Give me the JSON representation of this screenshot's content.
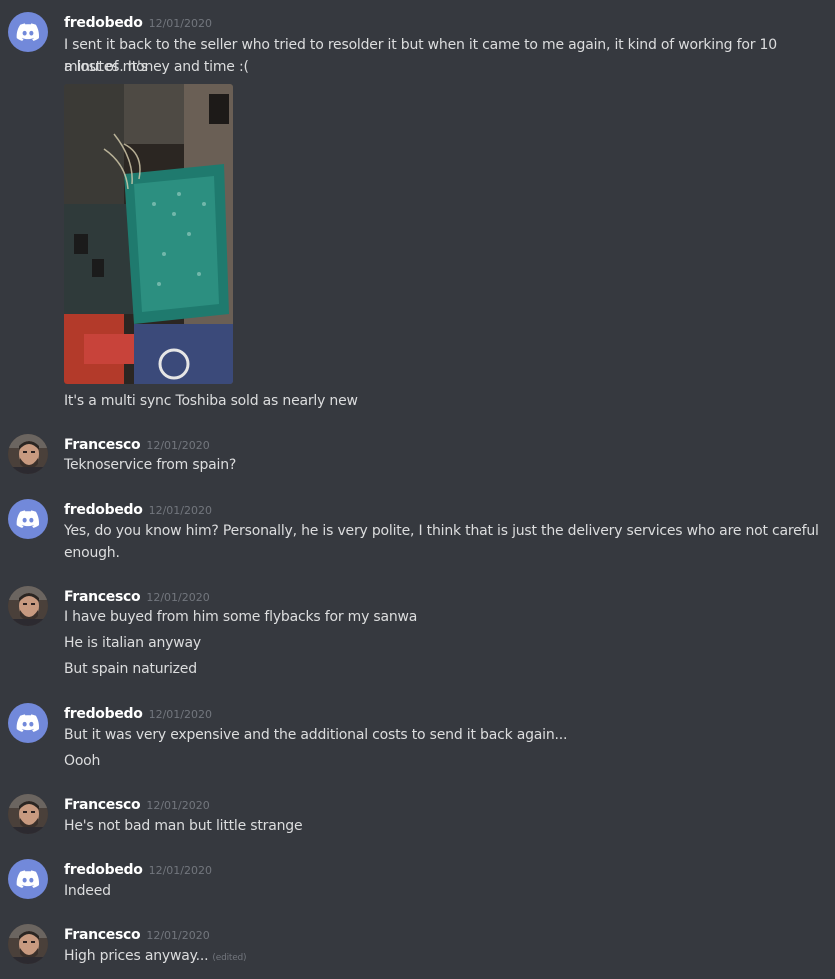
{
  "messages": [
    {
      "author": "fredobedo",
      "timestamp": "12/01/2020",
      "avatar_icon": "discord-logo-icon",
      "lines": [
        "I sent it back to the seller who tried to resolder it but when it came to me again, it kind of working for 10 minutes. It's",
        "a lost of money and time :(",
        "It's a multi sync Toshiba sold as nearly new"
      ],
      "attachment": "circuit-board-photo"
    },
    {
      "author": "Francesco",
      "timestamp": "12/01/2020",
      "avatar_icon": "user-photo-avatar",
      "lines": [
        "Teknoservice from spain?"
      ]
    },
    {
      "author": "fredobedo",
      "timestamp": "12/01/2020",
      "avatar_icon": "discord-logo-icon",
      "lines": [
        "Yes, do you know him? Personally, he is very polite, I think that is just the delivery services who are not careful",
        "enough."
      ]
    },
    {
      "author": "Francesco",
      "timestamp": "12/01/2020",
      "avatar_icon": "user-photo-avatar",
      "lines": [
        "I have buyed from him some flybacks for my sanwa",
        "He is italian anyway",
        "But spain naturized"
      ]
    },
    {
      "author": "fredobedo",
      "timestamp": "12/01/2020",
      "avatar_icon": "discord-logo-icon",
      "lines": [
        "But it was very expensive and the additional costs to send it back again...",
        "Oooh"
      ]
    },
    {
      "author": "Francesco",
      "timestamp": "12/01/2020",
      "avatar_icon": "user-photo-avatar",
      "lines": [
        "He's not bad man but little strange"
      ]
    },
    {
      "author": "fredobedo",
      "timestamp": "12/01/2020",
      "avatar_icon": "discord-logo-icon",
      "lines": [
        "Indeed"
      ]
    },
    {
      "author": "Francesco",
      "timestamp": "12/01/2020",
      "avatar_icon": "user-photo-avatar",
      "lines": [
        "High prices anyway..."
      ],
      "edited_label": "(edited)"
    }
  ],
  "colors": {
    "background": "#36393f",
    "username": "#ffffff",
    "text": "#dcddde",
    "timestamp": "#72767d",
    "discord_blurple": "#7289da"
  }
}
